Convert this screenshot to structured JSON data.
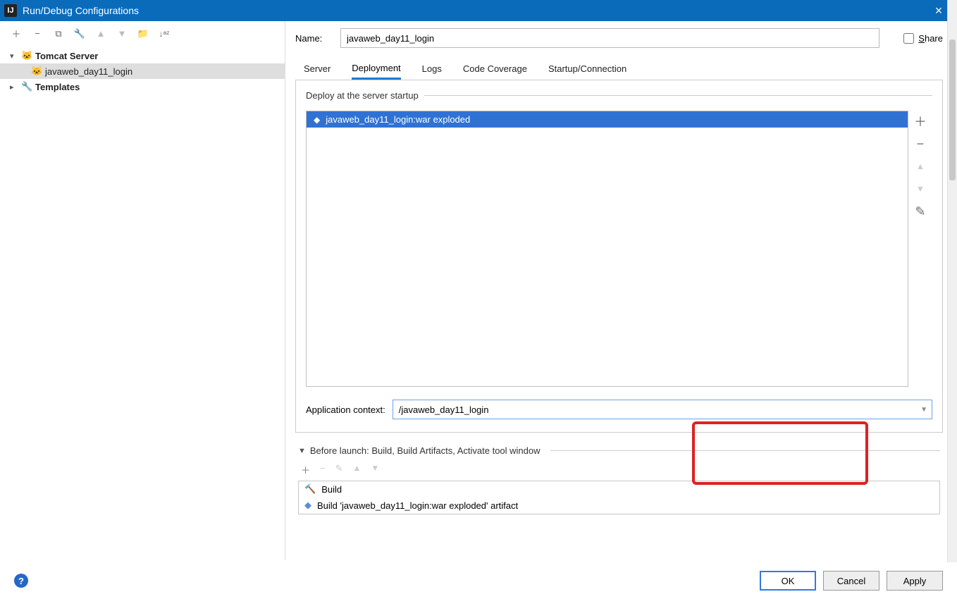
{
  "window": {
    "title": "Run/Debug Configurations"
  },
  "left": {
    "tree": {
      "tomcat_label": "Tomcat Server",
      "tomcat_child": "javaweb_day11_login",
      "templates_label": "Templates"
    }
  },
  "right": {
    "name_label": "Name:",
    "name_value": "javaweb_day11_login",
    "share_label": "Share",
    "tabs": {
      "server": "Server",
      "deployment": "Deployment",
      "logs": "Logs",
      "code_coverage": "Code Coverage",
      "startup": "Startup/Connection"
    },
    "deploy_legend": "Deploy at the server startup",
    "artifact_item": "javaweb_day11_login:war exploded",
    "context_label": "Application context:",
    "context_value": "/javaweb_day11_login",
    "before_launch_title": "Before launch: Build, Build Artifacts, Activate tool window",
    "bl_items": {
      "build": "Build",
      "artifact": "Build 'javaweb_day11_login:war exploded' artifact"
    }
  },
  "footer": {
    "ok": "OK",
    "cancel": "Cancel",
    "apply": "Apply"
  }
}
